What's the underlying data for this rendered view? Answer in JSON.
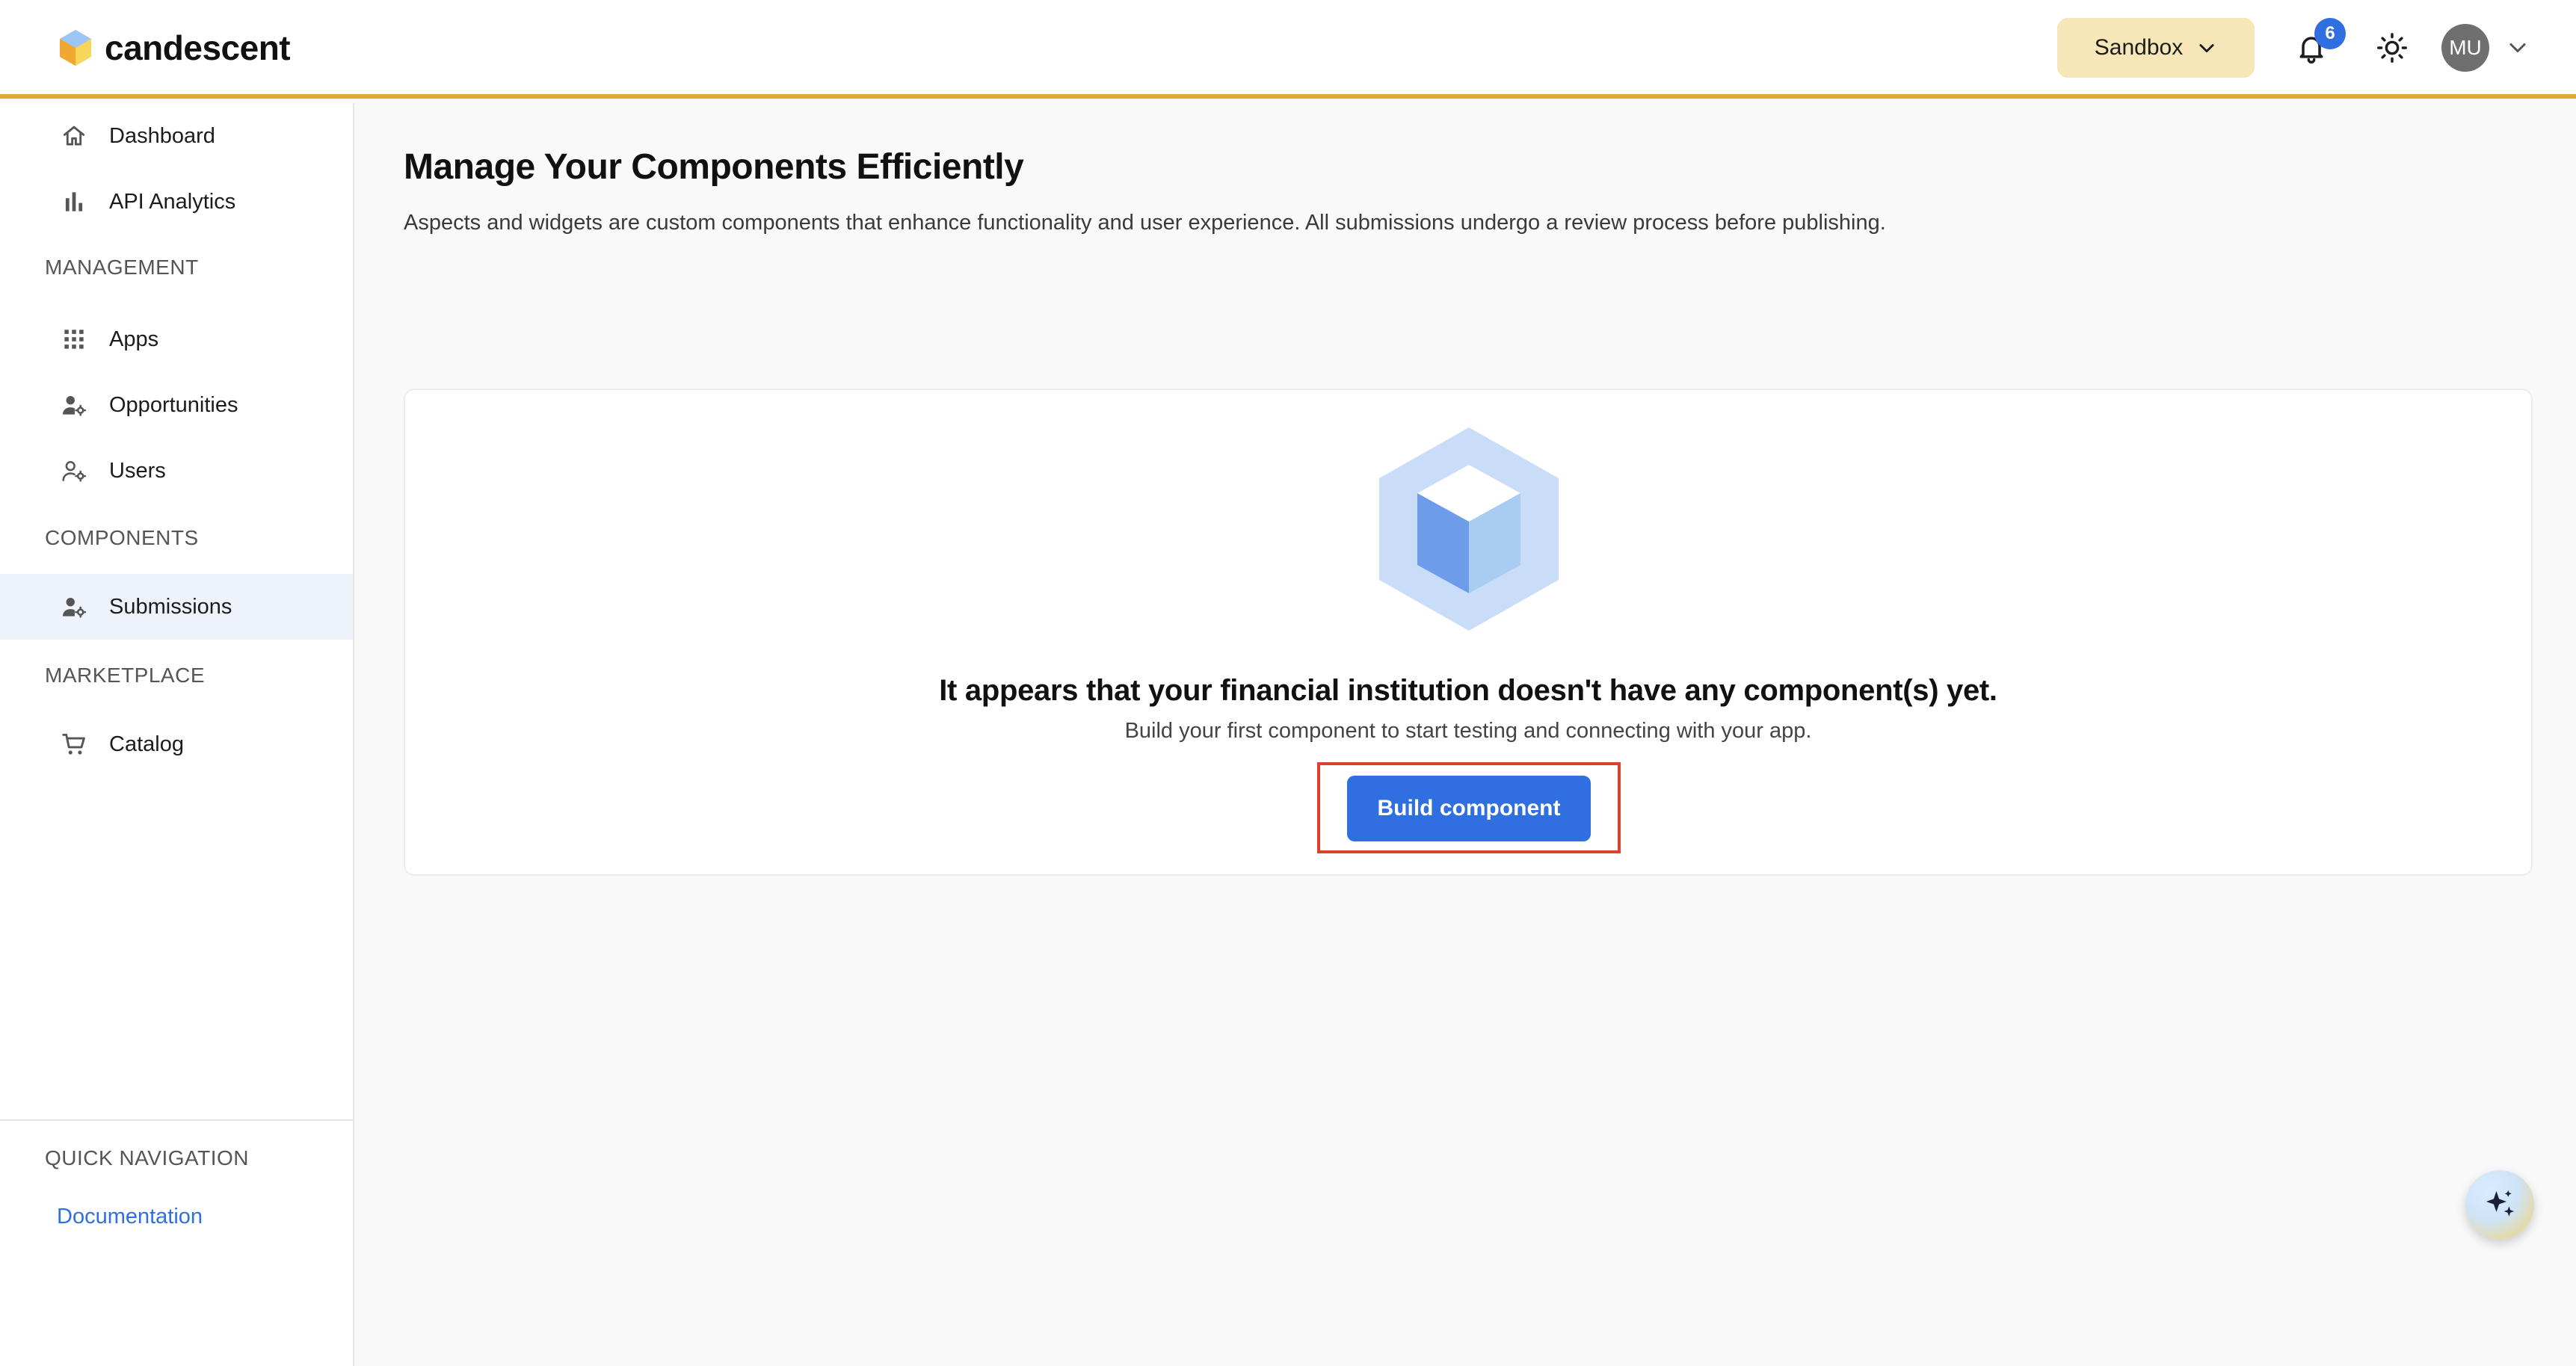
{
  "brand": {
    "name": "candescent"
  },
  "header": {
    "environment_label": "Sandbox",
    "notification_count": "6",
    "avatar_initials": "MU"
  },
  "sidebar": {
    "top_items": [
      {
        "label": "Dashboard",
        "icon": "home-icon"
      },
      {
        "label": "API Analytics",
        "icon": "bar-chart-icon"
      }
    ],
    "sections": [
      {
        "title": "MANAGEMENT",
        "items": [
          {
            "label": "Apps",
            "icon": "grid-icon"
          },
          {
            "label": "Opportunities",
            "icon": "user-gear-icon"
          },
          {
            "label": "Users",
            "icon": "user-gear-outline-icon"
          }
        ]
      },
      {
        "title": "COMPONENTS",
        "items": [
          {
            "label": "Submissions",
            "icon": "user-gear-icon",
            "active": true
          }
        ]
      },
      {
        "title": "MARKETPLACE",
        "items": [
          {
            "label": "Catalog",
            "icon": "cart-icon"
          }
        ]
      }
    ],
    "quick_nav": {
      "title": "QUICK NAVIGATION",
      "link": "Documentation"
    }
  },
  "main": {
    "title": "Manage Your Components Efficiently",
    "subtitle": "Aspects and widgets are custom components that enhance functionality and user experience. All submissions undergo a review process before publishing.",
    "empty_state": {
      "title": "It appears that your financial institution doesn't have any component(s) yet.",
      "description": "Build your first component to start testing and connecting with your app.",
      "button_label": "Build component"
    }
  },
  "colors": {
    "accent": "#2f6fe0",
    "header_border": "#dcac35",
    "sandbox_bg": "#f7e6b8",
    "active_nav_bg": "#eef2fb",
    "highlight_box": "#d8422f"
  }
}
